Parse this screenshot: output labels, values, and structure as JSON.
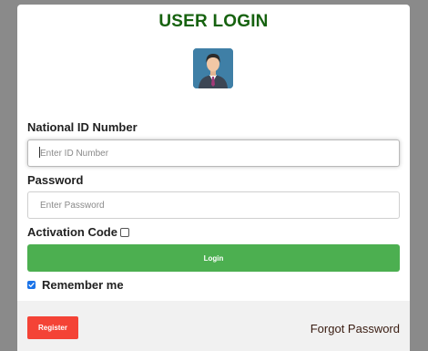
{
  "form": {
    "title": "USER LOGIN",
    "national_id": {
      "label": "National ID Number",
      "placeholder": "Enter ID Number",
      "value": ""
    },
    "password": {
      "label": "Password",
      "placeholder": "Enter Password",
      "value": ""
    },
    "activation_code": {
      "label": "Activation Code",
      "checked": false
    },
    "login_label": "Login",
    "remember_me": {
      "label": "Remember me",
      "checked": true
    }
  },
  "footer": {
    "register_label": "Register",
    "forgot_label": "Forgot Password"
  },
  "icons": {
    "avatar": "user-avatar-icon"
  },
  "colors": {
    "title": "#16620f",
    "login_button": "#4caf50",
    "register_button": "#f44336",
    "checkbox_checked": "#1a73e8",
    "footer_background": "#f1f1f1",
    "overlay": "#8a8a8a"
  }
}
